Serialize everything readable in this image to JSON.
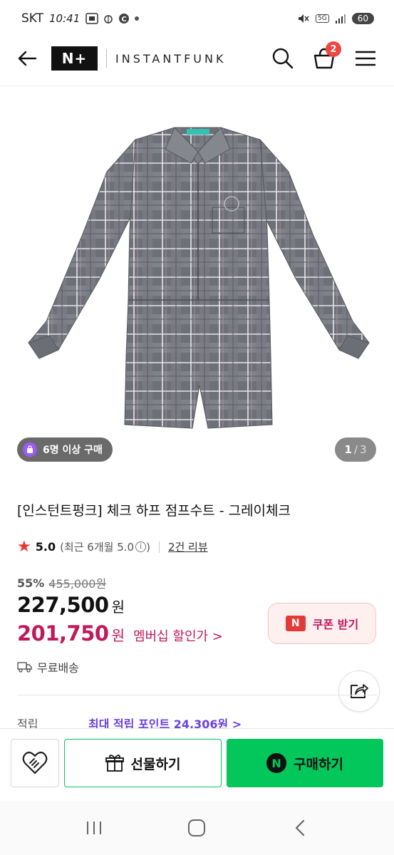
{
  "status_bar": {
    "carrier": "SKT",
    "time": "10:41",
    "network": "5G",
    "battery": "60"
  },
  "header": {
    "logo_text": "N+",
    "brand_name": "INSTANTFUNK",
    "cart_count": "2"
  },
  "gallery": {
    "buyers_badge": "6명 이상 구매",
    "current_page": "1",
    "separator": "/",
    "total_pages": "3"
  },
  "product": {
    "title": "[인스턴트펑크] 체크 하프 점프수트 - 그레이체크",
    "rating": "5.0",
    "rating_detail": "(최근 6개월 5.0",
    "rating_detail_close": ")",
    "review_count": "2건 리뷰",
    "discount_rate": "55%",
    "original_price": "455,000원",
    "price": "227,500",
    "price_unit": "원",
    "member_price": "201,750",
    "member_unit": "원",
    "member_label": "멤버십 할인가 >",
    "coupon_label": "쿠폰 받기",
    "coupon_icon_text": "N",
    "shipping": "무료배송",
    "points_label": "적립",
    "points_value": "최대 적립 포인트 24,306원 >"
  },
  "actions": {
    "gift_label": "선물하기",
    "buy_label": "구매하기",
    "npay_icon_text": "N"
  },
  "colors": {
    "naver_green": "#03c75a",
    "member_price": "#c2185b",
    "cart_badge": "#f0443e",
    "points": "#6a3fe0"
  }
}
